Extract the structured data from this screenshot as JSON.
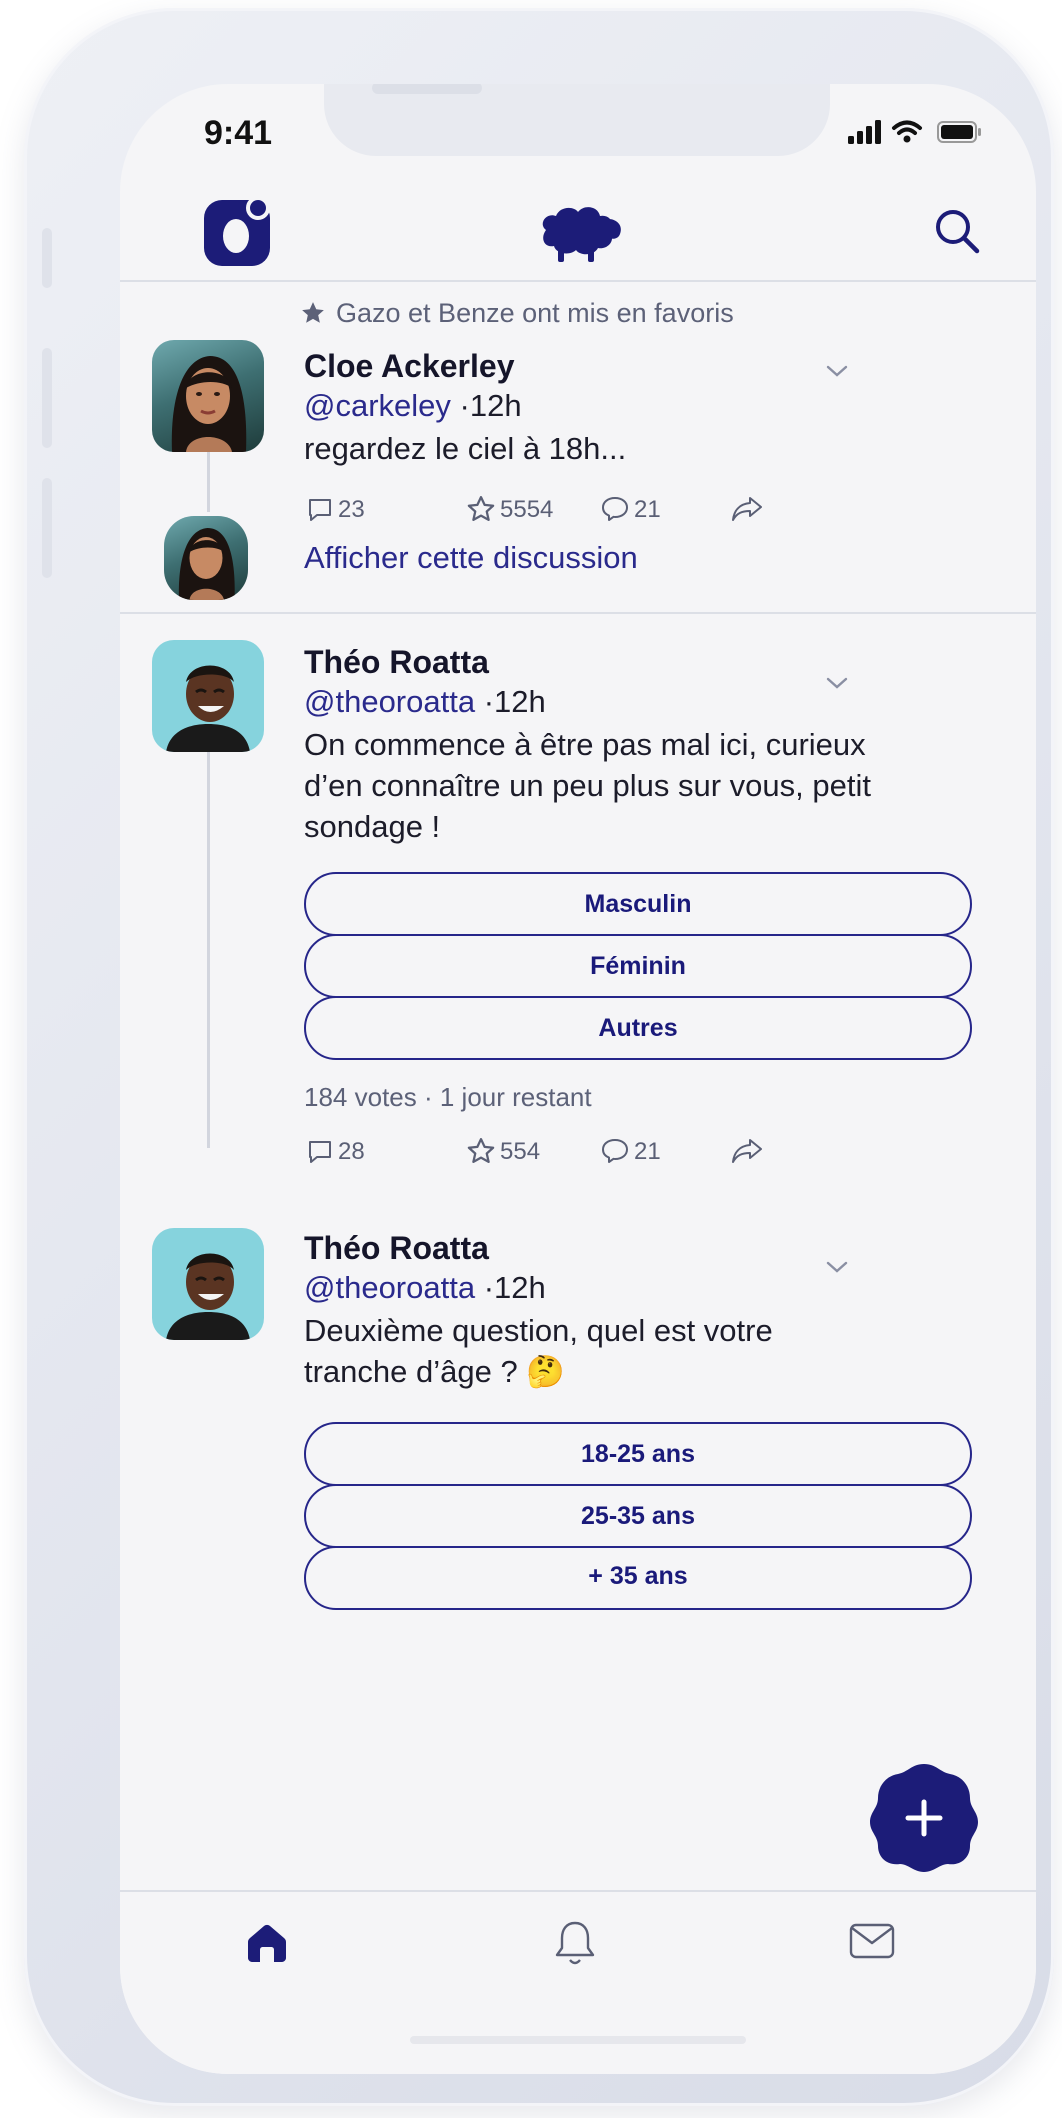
{
  "status_bar": {
    "time": "9:41"
  },
  "header": {
    "logo_icon": "app-logo-icon",
    "center_icon": "sheep-icon",
    "search_icon": "search-icon"
  },
  "feed": {
    "post1": {
      "context": "Gazo et Benze ont mis en favoris",
      "name": "Cloe Ackerley",
      "handle": "@carkeley",
      "time": "·12h",
      "text": "regardez le ciel à 18h...",
      "replies": "23",
      "likes": "5554",
      "reposts": "21",
      "show_thread": "Afficher cette discussion"
    },
    "post2": {
      "name": "Théo Roatta",
      "handle": "@theoroatta",
      "time": "·12h",
      "text_line1": "On commence à être pas mal ici, curieux",
      "text_line2": "d’en connaître un peu plus sur vous, petit",
      "text_line3": "sondage !",
      "poll_options": [
        "Masculin",
        "Féminin",
        "Autres"
      ],
      "poll_meta": "184 votes · 1 jour restant",
      "replies": "28",
      "likes": "554",
      "reposts": "21"
    },
    "post3": {
      "name": "Théo Roatta",
      "handle": "@theoroatta",
      "time": "·12h",
      "text_line1": "Deuxième question, quel est votre",
      "text_line2": "tranche d’âge ?",
      "emoji": "🤔",
      "poll_options": [
        "18-25 ans",
        "25-35 ans",
        "+ 35 ans"
      ]
    }
  },
  "fab": {
    "icon": "plus-icon"
  },
  "tabbar": {
    "items": [
      "home-icon",
      "bell-icon",
      "mail-icon"
    ]
  },
  "colors": {
    "brand_navy": "#1a1a7a",
    "background": "#f5f5f7",
    "divider": "#dcdfe6"
  }
}
